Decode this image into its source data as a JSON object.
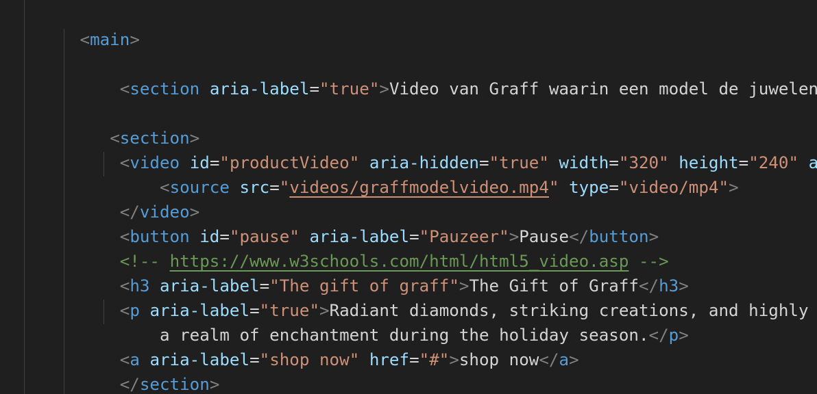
{
  "editor": {
    "language": "html",
    "lines": [
      {
        "indent": "    ",
        "main_tag": "main"
      },
      {
        "indent": ""
      },
      {
        "indent": "        ",
        "tag": "section",
        "attr": "aria-label",
        "value": "true",
        "text": "Video van Graff waarin een model de juwelen presenteert"
      },
      {
        "indent": ""
      },
      {
        "indent": "       ",
        "tag": "section"
      },
      {
        "indent": "        ",
        "tag": "video",
        "id_attr": "id",
        "id_value": "productVideo",
        "hidden_attr": "aria-hidden",
        "hidden_value": "true",
        "width_attr": "width",
        "width_value": "320",
        "height_attr": "height",
        "height_value": "240",
        "tail": "autoplay"
      },
      {
        "indent": "            ",
        "tag": "source",
        "src_attr": "src",
        "src_value": "videos/graffmodelvideo.mp4",
        "type_attr": "type",
        "type_value": "video/mp4"
      },
      {
        "indent": "        ",
        "close_tag": "video"
      },
      {
        "indent": "        ",
        "tag": "button",
        "id_attr": "id",
        "id_value": "pause",
        "label_attr": "aria-label",
        "label_value": "Pauzeer",
        "text": "Pause"
      },
      {
        "indent": "        ",
        "comment_open": "<!-- ",
        "comment_url": "https://www.w3schools.com/html/html5_video.asp",
        "comment_close": " -->"
      },
      {
        "indent": "        ",
        "tag": "h3",
        "attr": "aria-label",
        "value": "The gift of graff",
        "text": "The Gift of Graff"
      },
      {
        "indent": "        ",
        "tag": "p",
        "attr": "aria-label",
        "value": "true",
        "text": "Radiant diamonds, striking creations, and highly sought"
      },
      {
        "indent": "            ",
        "text": "a realm of enchantment during the holiday season.",
        "close_tag": "p"
      },
      {
        "indent": "        ",
        "tag": "a",
        "attr": "aria-label",
        "value": "shop now",
        "href_attr": "href",
        "href_value": "#",
        "text": "shop now"
      },
      {
        "indent": "        ",
        "close_tag": "section"
      }
    ]
  }
}
